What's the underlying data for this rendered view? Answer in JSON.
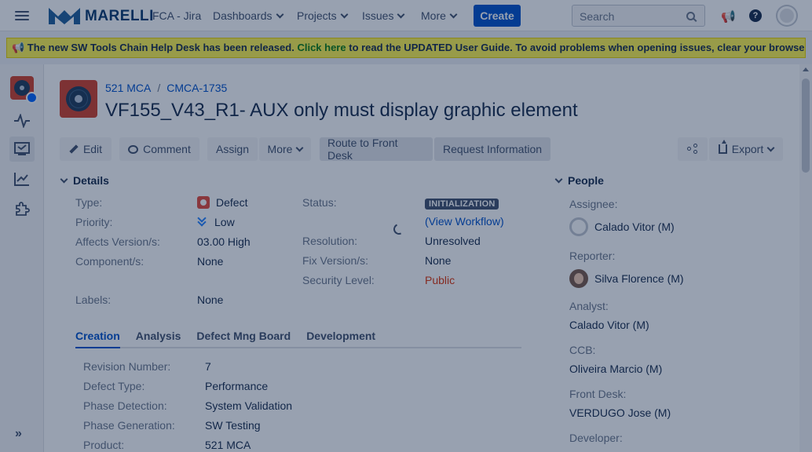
{
  "topnav": {
    "logo_text": "MARELLI",
    "site_name": "FCA - Jira",
    "items": [
      "Dashboards",
      "Projects",
      "Issues",
      "More"
    ],
    "create_label": "Create",
    "search_placeholder": "Search",
    "help_label": "?"
  },
  "banner": {
    "prefix": "📢 The new SW Tools Chain Help Desk has been released.",
    "link": "Click here",
    "suffix": "to read the UPDATED User Guide. To avoid problems when opening issues, clear your browser's"
  },
  "issue": {
    "project": "521 MCA",
    "key": "CMCA-1735",
    "title": "VF155_V43_R1- AUX only must display graphic element"
  },
  "toolbar": {
    "edit": "Edit",
    "comment": "Comment",
    "assign": "Assign",
    "more": "More",
    "route": "Route to Front Desk",
    "request": "Request Information",
    "export": "Export"
  },
  "details": {
    "heading": "Details",
    "type_label": "Type:",
    "type_value": "Defect",
    "priority_label": "Priority:",
    "priority_value": "Low",
    "affects_label": "Affects Version/s:",
    "affects_value": "03.00 High",
    "component_label": "Component/s:",
    "component_value": "None",
    "labels_label": "Labels:",
    "labels_value": "None",
    "status_label": "Status:",
    "status_value": "INITIALIZATION",
    "workflow_link": "(View Workflow)",
    "resolution_label": "Resolution:",
    "resolution_value": "Unresolved",
    "fixversion_label": "Fix Version/s:",
    "fixversion_value": "None",
    "security_label": "Security Level:",
    "security_value": "Public"
  },
  "tabs": [
    "Creation",
    "Analysis",
    "Defect Mng Board",
    "Development"
  ],
  "creation": [
    {
      "label": "Revision Number:",
      "value": "7"
    },
    {
      "label": "Defect Type:",
      "value": "Performance"
    },
    {
      "label": "Phase Detection:",
      "value": "System Validation"
    },
    {
      "label": "Phase Generation:",
      "value": "SW Testing"
    },
    {
      "label": "Product:",
      "value": "521 MCA"
    }
  ],
  "people": {
    "heading": "People",
    "assignee_label": "Assignee:",
    "assignee": "Calado Vitor (M)",
    "reporter_label": "Reporter:",
    "reporter": "Silva Florence (M)",
    "analyst_label": "Analyst:",
    "analyst": "Calado Vitor (M)",
    "ccb_label": "CCB:",
    "ccb": "Oliveira Marcio (M)",
    "frontdesk_label": "Front Desk:",
    "frontdesk": "VERDUGO Jose (M)",
    "developer_label": "Developer:"
  },
  "sidebar": {
    "icons": [
      "project-avatar-icon",
      "activity-icon",
      "board-icon",
      "reports-icon",
      "addons-icon"
    ],
    "expand_label": "»"
  },
  "colors": {
    "primary": "#0052cc",
    "banner": "#fff44f",
    "defect": "#e5493a",
    "public": "#de350b"
  }
}
